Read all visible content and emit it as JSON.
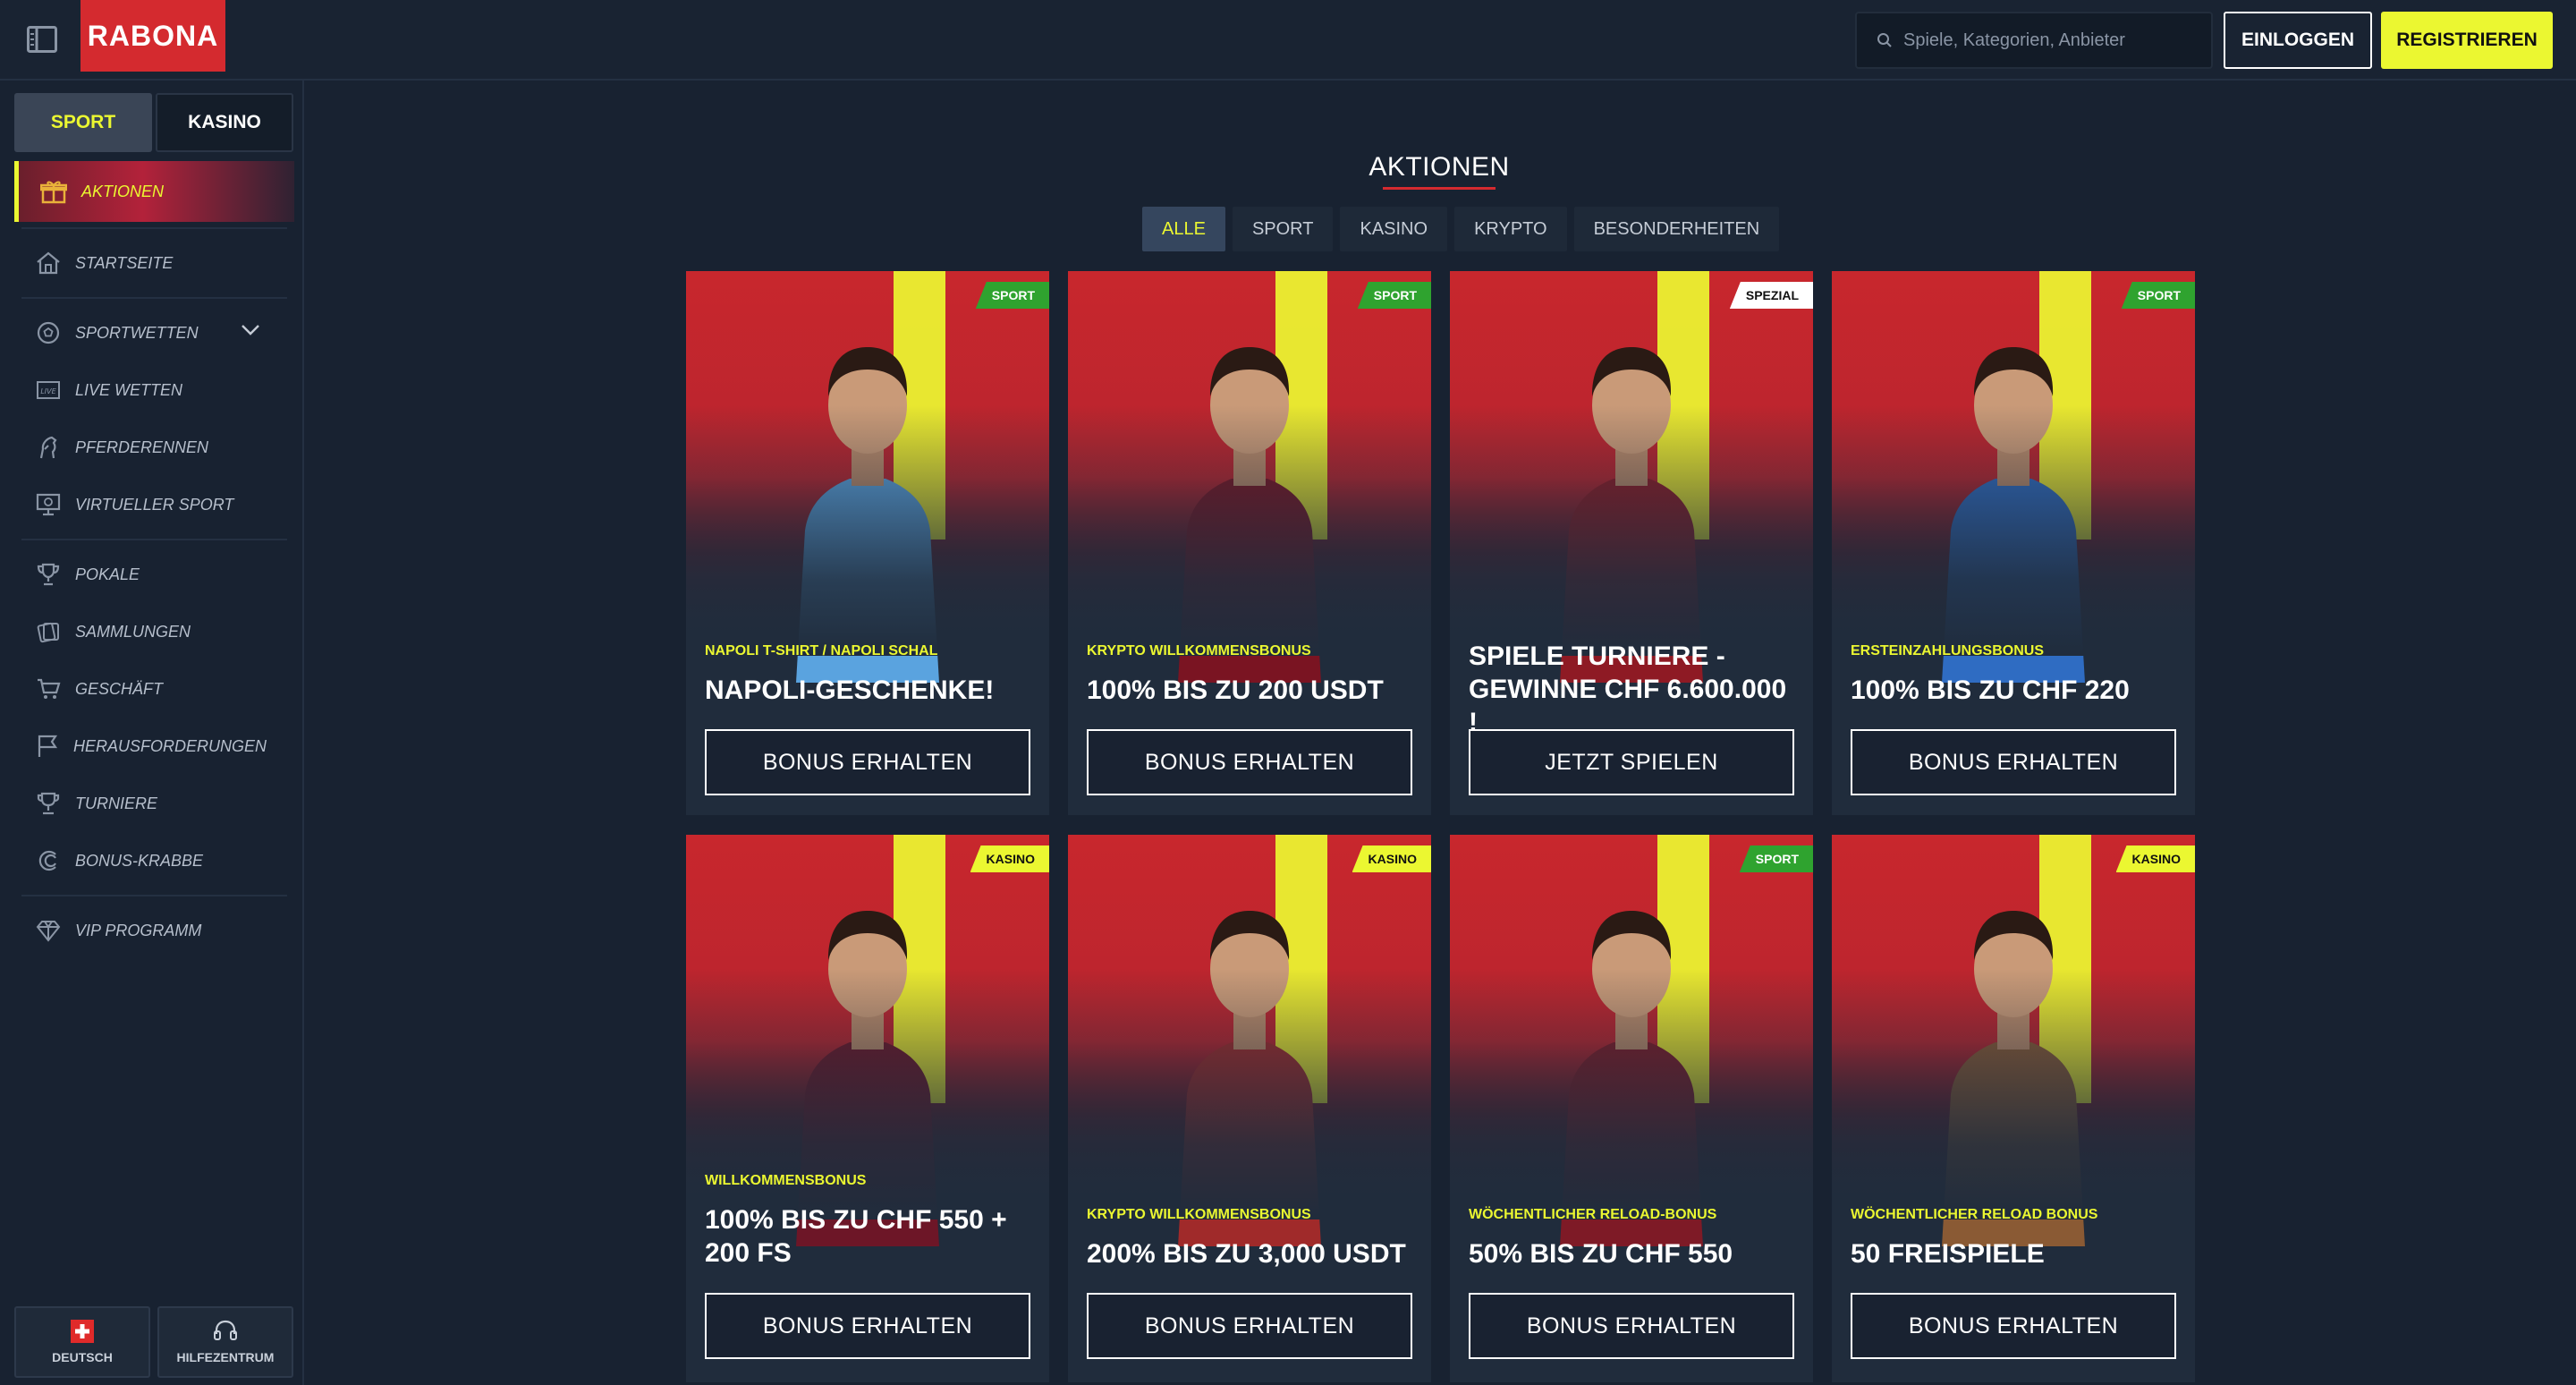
{
  "header": {
    "logo": "RABONA",
    "search_placeholder": "Spiele, Kategorien, Anbieter",
    "login_label": "EINLOGGEN",
    "register_label": "REGISTRIEREN"
  },
  "sidebar": {
    "segments": [
      {
        "label": "SPORT",
        "active": true
      },
      {
        "label": "KASINO",
        "active": false
      }
    ],
    "items": [
      {
        "label": "AKTIONEN",
        "icon": "gift-icon",
        "active": true
      },
      {
        "label": "STARTSEITE",
        "icon": "home-icon"
      },
      {
        "label": "SPORTWETTEN",
        "icon": "soccer-ball-icon",
        "expandable": true
      },
      {
        "label": "LIVE WETTEN",
        "icon": "live-icon"
      },
      {
        "label": "PFERDERENNEN",
        "icon": "horse-icon"
      },
      {
        "label": "VIRTUELLER SPORT",
        "icon": "monitor-icon"
      },
      {
        "label": "POKALE",
        "icon": "trophy-icon"
      },
      {
        "label": "SAMMLUNGEN",
        "icon": "collections-icon"
      },
      {
        "label": "GESCHÄFT",
        "icon": "cart-icon"
      },
      {
        "label": "HERAUSFORDERUNGEN",
        "icon": "flag-icon"
      },
      {
        "label": "TURNIERE",
        "icon": "cup-icon"
      },
      {
        "label": "BONUS-KRABBE",
        "icon": "crab-icon"
      },
      {
        "label": "VIP PROGRAMM",
        "icon": "diamond-icon"
      }
    ],
    "footer": {
      "language_label": "DEUTSCH",
      "help_label": "HILFEZENTRUM"
    }
  },
  "main": {
    "title": "AKTIONEN",
    "filters": [
      {
        "label": "ALLE",
        "active": true
      },
      {
        "label": "SPORT"
      },
      {
        "label": "KASINO"
      },
      {
        "label": "KRYPTO"
      },
      {
        "label": "BESONDERHEITEN"
      }
    ],
    "cards": [
      {
        "badge": "SPORT",
        "badge_type": "sport",
        "subtitle": "NAPOLI T-SHIRT / NAPOLI SCHAL",
        "headline": "NAPOLI-GESCHENKE!",
        "cta": "BONUS ERHALTEN",
        "shirt": "#5aa3df"
      },
      {
        "badge": "SPORT",
        "badge_type": "sport",
        "subtitle": "KRYPTO WILLKOMMENSBONUS",
        "headline": "100% BIS ZU 200 USDT",
        "cta": "BONUS ERHALTEN",
        "shirt": "#7a1422"
      },
      {
        "badge": "SPEZIAL",
        "badge_type": "spezial",
        "subtitle": "",
        "headline": "SPIELE TURNIERE - GEWINNE CHF 6.600.000 !",
        "cta": "JETZT SPIELEN",
        "shirt": "#8e1a24"
      },
      {
        "badge": "SPORT",
        "badge_type": "sport",
        "subtitle": "ERSTEINZAHLUNGSBONUS",
        "headline": "100% BIS ZU CHF 220",
        "cta": "BONUS ERHALTEN",
        "shirt": "#2f6cc2"
      },
      {
        "badge": "KASINO",
        "badge_type": "kasino",
        "subtitle": "WILLKOMMENSBONUS",
        "headline": "100% BIS ZU CHF 550 + 200 FS",
        "cta": "BONUS ERHALTEN",
        "shirt": "#6d1627"
      },
      {
        "badge": "KASINO",
        "badge_type": "kasino",
        "subtitle": "KRYPTO WILLKOMMENSBONUS",
        "headline": "200% BIS ZU 3,000 USDT",
        "cta": "BONUS ERHALTEN",
        "shirt": "#a02a2a"
      },
      {
        "badge": "SPORT",
        "badge_type": "sport",
        "subtitle": "WÖCHENTLICHER RELOAD-BONUS",
        "headline": "50% BIS ZU CHF 550",
        "cta": "BONUS ERHALTEN",
        "shirt": "#7e1a26"
      },
      {
        "badge": "KASINO",
        "badge_type": "kasino",
        "subtitle": "WÖCHENTLICHER RELOAD BONUS",
        "headline": "50 FREISPIELE",
        "cta": "BONUS ERHALTEN",
        "shirt": "#8a5a34"
      }
    ]
  },
  "colors": {
    "accent": "#ebf731",
    "brand_red": "#d42a2f",
    "sport_badge": "#2fa32f",
    "background": "#182231"
  }
}
